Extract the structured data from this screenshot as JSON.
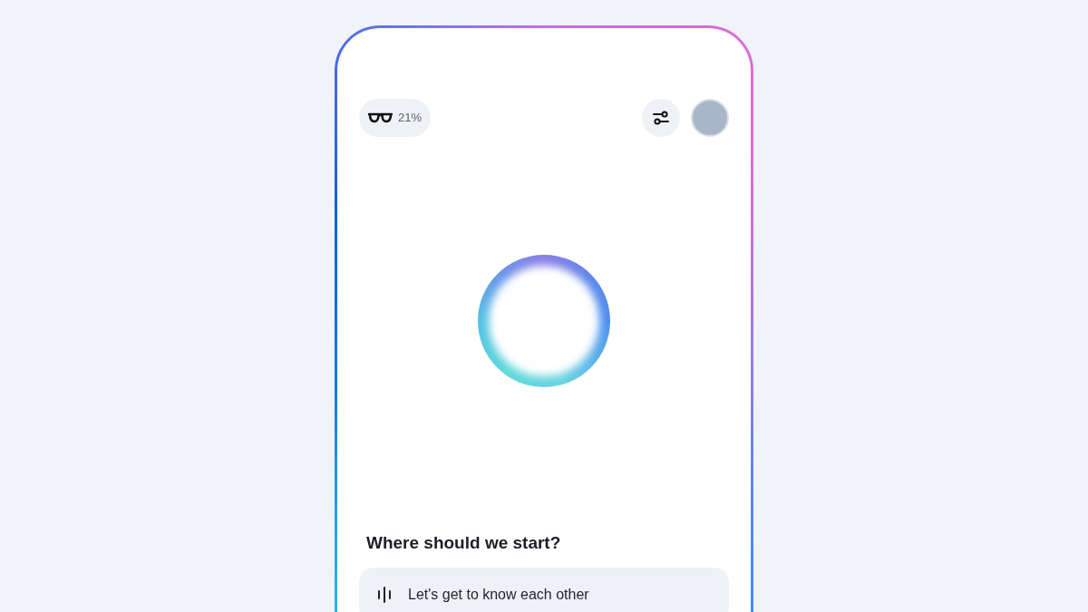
{
  "top_bar": {
    "glasses_badge": "21%"
  },
  "prompt": {
    "heading": "Where should we start?",
    "options": [
      {
        "label": "Let's get to know each other"
      }
    ]
  }
}
